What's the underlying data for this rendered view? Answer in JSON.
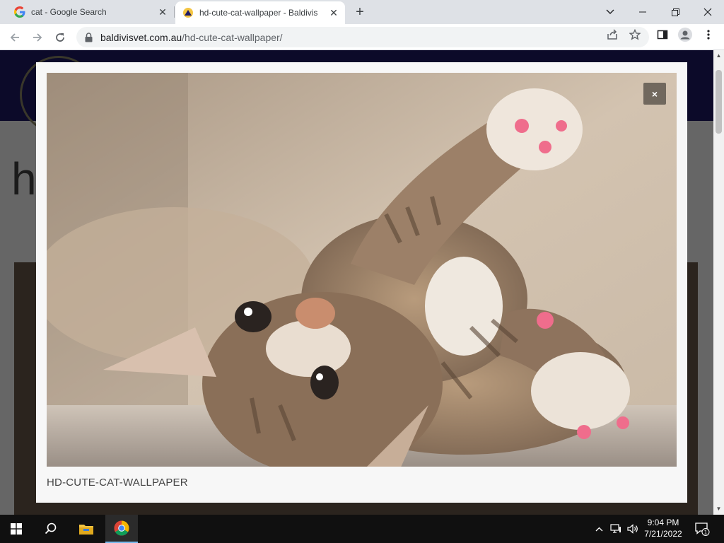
{
  "browser": {
    "tabs": [
      {
        "title": "cat - Google Search",
        "favicon": "google-icon",
        "active": false
      },
      {
        "title": "hd-cute-cat-wallpaper - Baldivis",
        "favicon": "baldivis-vet-icon",
        "active": true
      }
    ],
    "url_host": "baldivisvet.com.au",
    "url_path": "/hd-cute-cat-wallpaper/"
  },
  "page": {
    "heading_partial": "h"
  },
  "lightbox": {
    "caption": "HD-CUTE-CAT-WALLPAPER",
    "close_label": "×",
    "image_subject": "tabby kitten lying on its back with paws raised"
  },
  "taskbar": {
    "time": "9:04 PM",
    "date": "7/21/2022",
    "notification_count": "1"
  },
  "colors": {
    "site_header": "#1f1b66",
    "tab_strip": "#dee1e6",
    "taskbar": "#101010"
  }
}
